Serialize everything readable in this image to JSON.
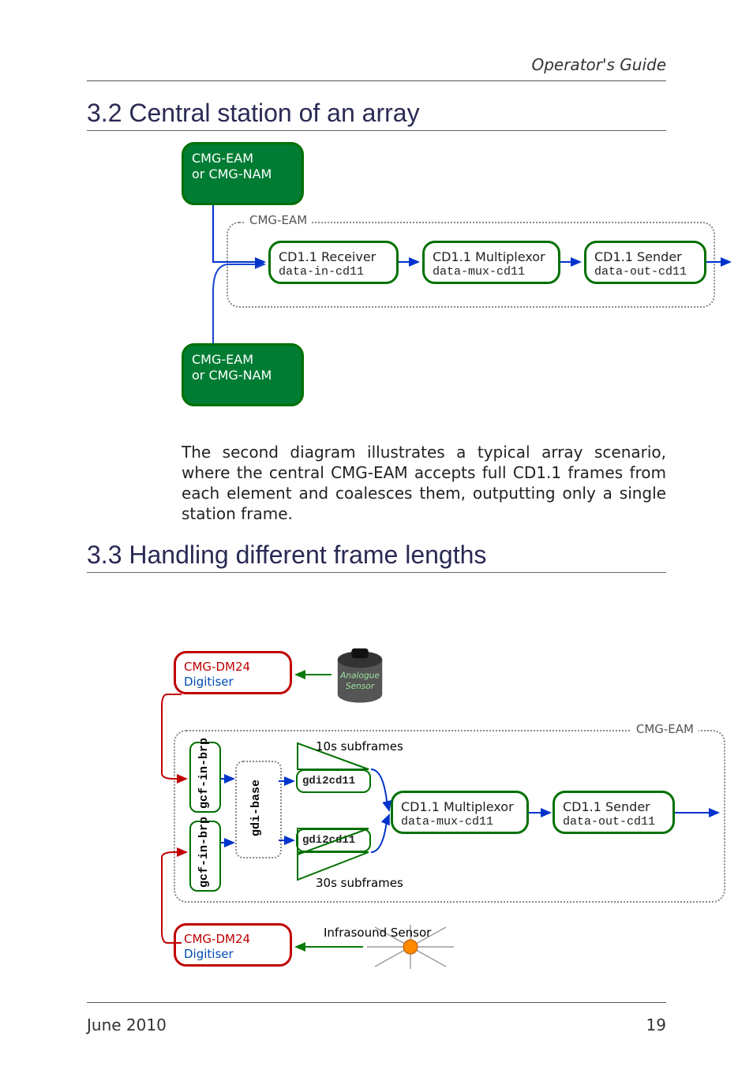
{
  "header": {
    "running_head": "Operator's Guide"
  },
  "sections": {
    "s32": {
      "num": "3.2",
      "title": "Central station of an array"
    },
    "s33": {
      "num": "3.3",
      "title": "Handling different frame lengths"
    }
  },
  "body": {
    "para1": "The second diagram illustrates a typical array scenario, where the central CMG-EAM accepts full CD1.1 frames from each element and coalesces them, outputting only a single station frame."
  },
  "diagram1": {
    "container_label": "CMG-EAM",
    "source_a_l1": "CMG-EAM",
    "source_a_l2": "or CMG-NAM",
    "source_b_l1": "CMG-EAM",
    "source_b_l2": "or CMG-NAM",
    "rx_title": "CD1.1 Receiver",
    "rx_cmd": "data-in-cd11",
    "mux_title": "CD1.1 Multiplexor",
    "mux_cmd": "data-mux-cd11",
    "tx_title": "CD1.1 Sender",
    "tx_cmd": "data-out-cd11"
  },
  "diagram2": {
    "container_label": "CMG-EAM",
    "digitiser_top_l1": "CMG-DM24",
    "digitiser_top_l2": "Digitiser",
    "digitiser_bot_l1": "CMG-DM24",
    "digitiser_bot_l2": "Digitiser",
    "analogue_sensor_lbl": "Analogue Sensor",
    "gcf_in_brp": "gcf-in-brp",
    "gdi_base": "gdi-base",
    "gdi2cd11": "gdi2cd11",
    "subframes_10s": "10s subframes",
    "subframes_30s": "30s subframes",
    "mux_title": "CD1.1 Multiplexor",
    "mux_cmd": "data-mux-cd11",
    "tx_title": "CD1.1 Sender",
    "tx_cmd": "data-out-cd11",
    "infrasound_label": "Infrasound Sensor"
  },
  "footer": {
    "left": "June 2010",
    "right": "19"
  }
}
